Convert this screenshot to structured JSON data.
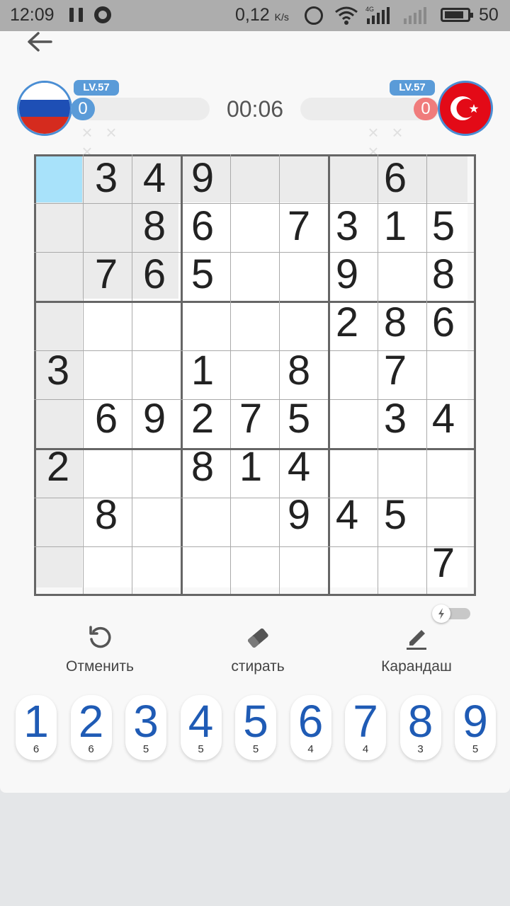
{
  "status_bar": {
    "time": "12:09",
    "speed": "0,12",
    "speed_unit": "K/s",
    "network_label": "4G",
    "battery": "50"
  },
  "header": {
    "back_icon": "arrow-left-icon"
  },
  "players": {
    "left": {
      "flag": "russia",
      "level": "LV.57",
      "score": "0",
      "mistakes": [
        "×",
        "×",
        "×"
      ]
    },
    "right": {
      "flag": "turkey",
      "level": "LV.57",
      "score": "0",
      "mistakes": [
        "×",
        "×",
        "×"
      ]
    }
  },
  "timer": "00:06",
  "board": {
    "selected": [
      0,
      0
    ],
    "cells": [
      [
        "",
        "3",
        "4",
        "9",
        "",
        "",
        "",
        "6",
        ""
      ],
      [
        "",
        "",
        "8",
        "6",
        "",
        "7",
        "3",
        "1",
        "5"
      ],
      [
        "",
        "7",
        "6",
        "5",
        "",
        "",
        "9",
        "",
        "8"
      ],
      [
        "",
        "",
        "",
        "",
        "",
        "",
        "2",
        "8",
        "6"
      ],
      [
        "3",
        "",
        "",
        "1",
        "",
        "8",
        "",
        "7",
        ""
      ],
      [
        "",
        "6",
        "9",
        "2",
        "7",
        "5",
        "",
        "3",
        "4"
      ],
      [
        "2",
        "",
        "",
        "8",
        "1",
        "4",
        "",
        "",
        ""
      ],
      [
        "",
        "8",
        "",
        "",
        "",
        "9",
        "4",
        "5",
        ""
      ],
      [
        "",
        "",
        "",
        "",
        "",
        "",
        "",
        "",
        "7"
      ]
    ]
  },
  "toolbar": {
    "undo_label": "Отменить",
    "erase_label": "стирать",
    "pencil_label": "Карандаш"
  },
  "numpad": [
    {
      "digit": "1",
      "count": "6"
    },
    {
      "digit": "2",
      "count": "6"
    },
    {
      "digit": "3",
      "count": "5"
    },
    {
      "digit": "4",
      "count": "5"
    },
    {
      "digit": "5",
      "count": "5"
    },
    {
      "digit": "6",
      "count": "4"
    },
    {
      "digit": "7",
      "count": "4"
    },
    {
      "digit": "8",
      "count": "3"
    },
    {
      "digit": "9",
      "count": "5"
    }
  ],
  "colors": {
    "accent_blue": "#5a9bd8",
    "opponent_red": "#f07c7c",
    "digit_blue": "#1f5bb5",
    "selected_cell": "#a8e2fa",
    "highlight_cell": "#ebebeb"
  }
}
